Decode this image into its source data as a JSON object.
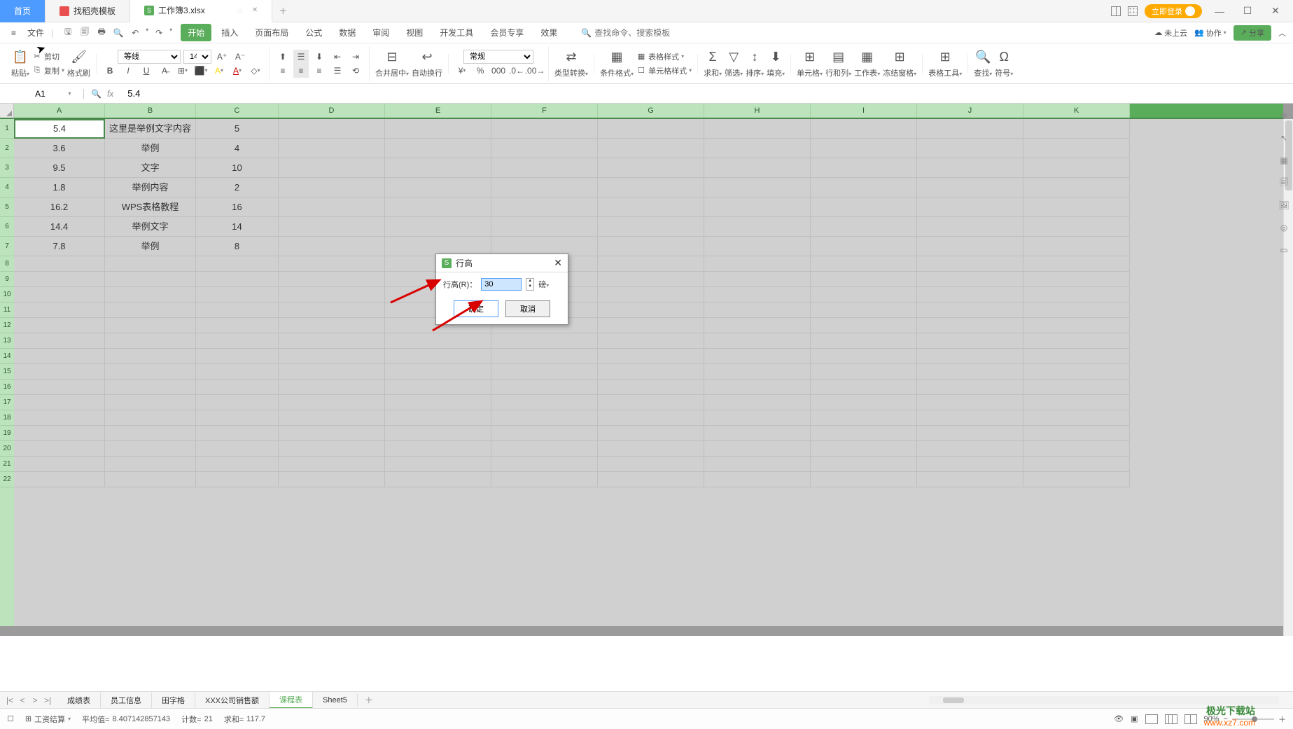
{
  "title_tabs": {
    "home": "首页",
    "tab1": "找稻壳模板",
    "tab2": "工作簿3.xlsx",
    "login": "立即登录"
  },
  "menu": {
    "file": "文件",
    "tabs": [
      "开始",
      "插入",
      "页面布局",
      "公式",
      "数据",
      "审阅",
      "视图",
      "开发工具",
      "会员专享",
      "效果"
    ],
    "search_placeholder": "查找命令、搜索模板",
    "cloud": "未上云",
    "collab": "协作",
    "share": "分享"
  },
  "ribbon": {
    "paste": "粘贴",
    "cut": "剪切",
    "copy": "复制",
    "format_painter": "格式刷",
    "font_name": "等线",
    "font_size": "14",
    "merge": "合并居中",
    "wrap": "自动换行",
    "num_format": "常规",
    "type_convert": "类型转换",
    "cond_format": "条件格式",
    "table_style": "表格样式",
    "cell_style": "单元格样式",
    "sum": "求和",
    "filter": "筛选",
    "sort": "排序",
    "fill": "填充",
    "cells": "单元格",
    "rowcol": "行和列",
    "sheet": "工作表",
    "freeze": "冻结窗格",
    "tools": "表格工具",
    "find": "查找",
    "symbol": "符号"
  },
  "formula_bar": {
    "name_box": "A1",
    "formula": "5.4"
  },
  "columns": [
    "A",
    "B",
    "C",
    "D",
    "E",
    "F",
    "G",
    "H",
    "I",
    "J",
    "K"
  ],
  "rows": [
    "1",
    "2",
    "3",
    "4",
    "5",
    "6",
    "7",
    "8",
    "9",
    "10",
    "11",
    "12",
    "13",
    "14",
    "15",
    "16",
    "17",
    "18",
    "19",
    "20",
    "21",
    "22"
  ],
  "grid_data": [
    {
      "a": "5.4",
      "b": "这里是举例文字内容",
      "c": "5"
    },
    {
      "a": "3.6",
      "b": "举例",
      "c": "4"
    },
    {
      "a": "9.5",
      "b": "文字",
      "c": "10"
    },
    {
      "a": "1.8",
      "b": "举例内容",
      "c": "2"
    },
    {
      "a": "16.2",
      "b": "WPS表格教程",
      "c": "16"
    },
    {
      "a": "14.4",
      "b": "举例文字",
      "c": "14"
    },
    {
      "a": "7.8",
      "b": "举例",
      "c": "8"
    }
  ],
  "dialog": {
    "title": "行高",
    "label": "行高(R)：",
    "value": "30",
    "unit": "磅",
    "ok": "确定",
    "cancel": "取消"
  },
  "sheets": {
    "nav": [
      "|<",
      "<",
      ">",
      ">|"
    ],
    "tabs": [
      "成绩表",
      "员工信息",
      "田字格",
      "XXX公司销售额",
      "课程表",
      "Sheet5"
    ]
  },
  "status": {
    "calc": "工资结算",
    "avg_label": "平均值=",
    "avg": "8.407142857143",
    "count_label": "计数=",
    "count": "21",
    "sum_label": "求和=",
    "sum": "117.7",
    "zoom": "90%"
  },
  "watermark": {
    "l1": "极光下载站",
    "l2": "www.xz7.com"
  }
}
